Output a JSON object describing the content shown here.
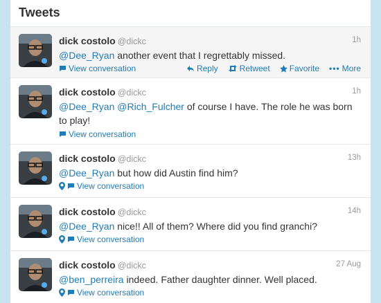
{
  "header": {
    "title": "Tweets"
  },
  "tweets": [
    {
      "name": "dick costolo",
      "handle": "@dickc",
      "time": "1h",
      "mentions": [
        "@Dee_Ryan"
      ],
      "text": " another event that I regrettably missed.",
      "conversation": "View conversation",
      "actions": {
        "reply": "Reply",
        "retweet": "Retweet",
        "favorite": "Favorite",
        "more": "More"
      }
    },
    {
      "name": "dick costolo",
      "handle": "@dickc",
      "time": "1h",
      "mentions": [
        "@Dee_Ryan",
        "@Rich_Fulcher"
      ],
      "text": " of course I have.  The role he was born to play!",
      "conversation": "View conversation"
    },
    {
      "name": "dick costolo",
      "handle": "@dickc",
      "time": "13h",
      "mentions": [
        "@Dee_Ryan"
      ],
      "text": " but how did Austin find him?",
      "conversation": "View conversation"
    },
    {
      "name": "dick costolo",
      "handle": "@dickc",
      "time": "14h",
      "mentions": [
        "@Dee_Ryan"
      ],
      "text": " nice!! All of them? Where did you find granchi?",
      "conversation": "View conversation"
    },
    {
      "name": "dick costolo",
      "handle": "@dickc",
      "time": "27 Aug",
      "mentions": [
        "@ben_perreira"
      ],
      "text": " indeed. Father daughter dinner.  Well placed.",
      "conversation": "View conversation"
    }
  ]
}
